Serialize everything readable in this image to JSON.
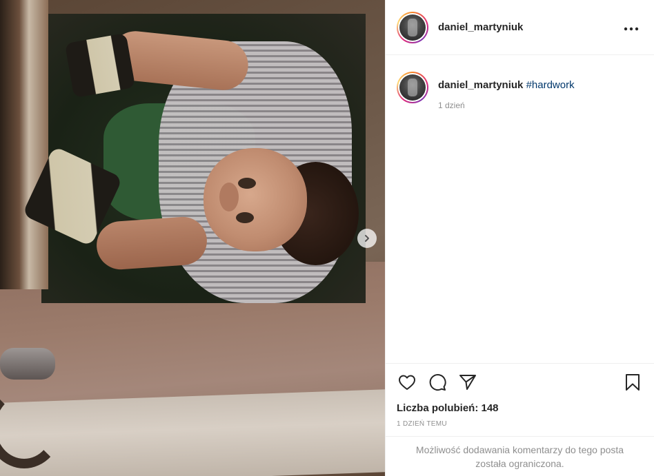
{
  "post": {
    "username": "daniel_martyniuk",
    "caption": {
      "username": "daniel_martyniuk",
      "hashtag": "#hardwork",
      "relative_time": "1 dzień"
    },
    "likes_label": "Liczba polubień: 148",
    "date_label": "1 DZIEŃ TEMU",
    "comments_restricted": "Możliwość dodawania komentarzy do tego posta została ograniczona."
  },
  "icons": {
    "more": "more-options-icon",
    "next": "chevron-right-icon",
    "like": "heart-icon",
    "comment": "comment-bubble-icon",
    "share": "paper-plane-icon",
    "save": "bookmark-icon"
  },
  "colors": {
    "text": "#262626",
    "muted": "#8e8e8e",
    "hashtag": "#00376b",
    "border": "#efefef",
    "story_ring": [
      "#f58529",
      "#dd2a7b",
      "#8134af"
    ]
  }
}
